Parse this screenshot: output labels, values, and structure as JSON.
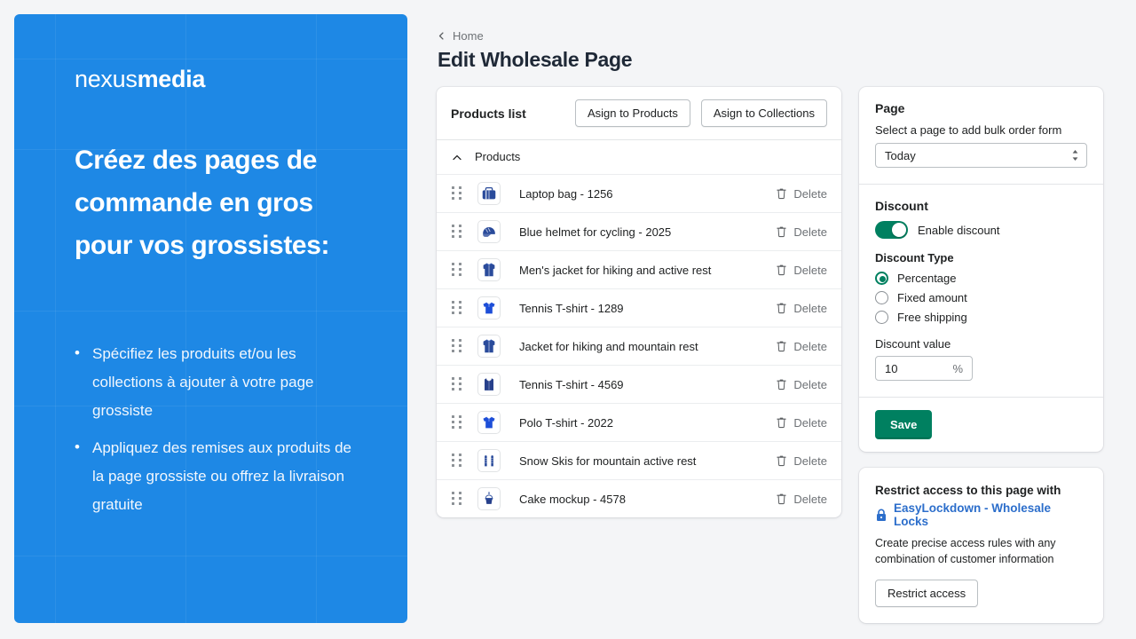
{
  "promo": {
    "logo_light": "nexus",
    "logo_bold": "media",
    "headline": "Créez des pages de commande en gros pour vos grossistes:",
    "bullets": [
      "Spécifiez les produits et/ou les collections à ajouter à votre page grossiste",
      "Appliquez des remises aux produits de la page grossiste ou offrez la livraison gratuite"
    ],
    "background_color": "#1e88e5"
  },
  "breadcrumb": {
    "label": "Home",
    "icon": "chevron-left-icon"
  },
  "page_title": "Edit Wholesale Page",
  "products_card": {
    "title": "Products list",
    "assign_products_label": "Asign to Products",
    "assign_collections_label": "Asign to Collections",
    "group_label": "Products",
    "group_caret": "chevron-up-icon",
    "delete_label": "Delete",
    "rows": [
      {
        "name": "Laptop bag - 1256",
        "thumb": "laptop-bag-icon"
      },
      {
        "name": "Blue helmet for cycling - 2025",
        "thumb": "helmet-icon"
      },
      {
        "name": "Men's jacket for hiking and active rest",
        "thumb": "jacket-icon"
      },
      {
        "name": "Tennis T-shirt - 1289",
        "thumb": "polo-shirt-icon"
      },
      {
        "name": "Jacket for hiking and mountain rest",
        "thumb": "jacket-icon"
      },
      {
        "name": "Tennis T-shirt - 4569",
        "thumb": "tank-top-icon"
      },
      {
        "name": "Polo T-shirt - 2022",
        "thumb": "polo-shirt-icon"
      },
      {
        "name": "Snow Skis for mountain active rest",
        "thumb": "skis-icon"
      },
      {
        "name": "Cake mockup - 4578",
        "thumb": "cupcake-icon"
      }
    ]
  },
  "page_section": {
    "heading": "Page",
    "helper": "Select a page to add bulk order form",
    "select_value": "Today",
    "select_options": [
      "Today"
    ]
  },
  "discount_section": {
    "heading": "Discount",
    "toggle_label": "Enable discount",
    "toggle_on": true,
    "toggle_color": "#008060",
    "type_label": "Discount Type",
    "types": [
      {
        "label": "Percentage",
        "selected": true
      },
      {
        "label": "Fixed amount",
        "selected": false
      },
      {
        "label": "Free shipping",
        "selected": false
      }
    ],
    "value_label": "Discount value",
    "value": "10",
    "value_suffix": "%",
    "save_label": "Save"
  },
  "lock_card": {
    "title": "Restrict access to this page with",
    "link_text": "EasyLockdown - Wholesale Locks",
    "link_color": "#2c6ecb",
    "link_icon": "lock-icon",
    "description": "Create precise access rules with any combination of customer information",
    "button_label": "Restrict access"
  }
}
